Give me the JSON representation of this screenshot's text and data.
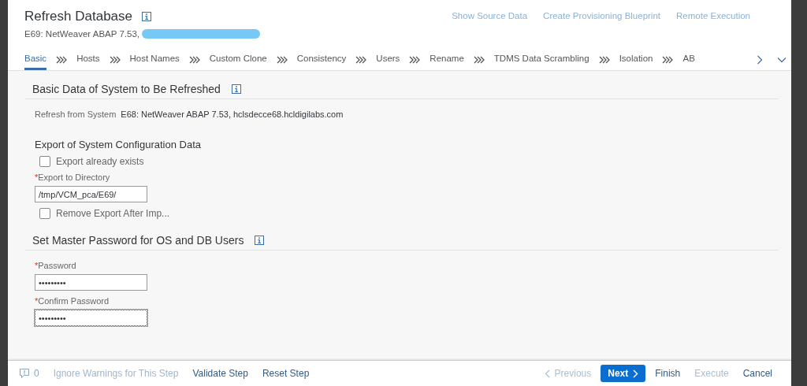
{
  "required_mark": "*",
  "dialog": {
    "title": "Refresh Database",
    "subtitle": "E69: NetWeaver ABAP 7.53,",
    "subtitle_redacted": true,
    "header_links": [
      {
        "label": "Show Source Data",
        "disabled": true
      },
      {
        "label": "Create Provisioning Blueprint",
        "disabled": true
      },
      {
        "label": "Remote Execution",
        "disabled": true
      }
    ]
  },
  "tabs": [
    {
      "label": "Basic",
      "selected": true
    },
    {
      "label": "Hosts",
      "selected": false
    },
    {
      "label": "Host Names",
      "selected": false
    },
    {
      "label": "Custom Clone",
      "selected": false
    },
    {
      "label": "Consistency",
      "selected": false
    },
    {
      "label": "Users",
      "selected": false
    },
    {
      "label": "Rename",
      "selected": false
    },
    {
      "label": "TDMS Data Scrambling",
      "selected": false
    },
    {
      "label": "Isolation",
      "selected": false
    },
    {
      "label": "AB",
      "selected": false
    }
  ],
  "sections": [
    {
      "title": "Basic Data of System to Be Refreshed",
      "info": true,
      "items": [
        {
          "kind": "pair",
          "label": "Refresh from System",
          "value": "E68: NetWeaver ABAP 7.53, hclsdecce68.hcldigilabs.com"
        },
        {
          "kind": "heading",
          "label": "Export of System Configuration Data"
        },
        {
          "kind": "checkbox",
          "label": "Export already exists",
          "checked": false
        },
        {
          "kind": "field",
          "label": "Export to Directory",
          "required": true,
          "value": "/tmp/VCM_pca/E69/",
          "focused": false
        },
        {
          "kind": "checkbox",
          "label": "Remove Export After Imp...",
          "checked": false
        }
      ]
    },
    {
      "title": "Set Master Password for OS and DB Users",
      "info": true,
      "items": [
        {
          "kind": "field",
          "label": "Password",
          "required": true,
          "value": "•••••••••",
          "focused": false
        },
        {
          "kind": "field",
          "label": "Confirm Password",
          "required": true,
          "value": "•••••••••",
          "focused": true
        }
      ]
    }
  ],
  "footer": {
    "message_count": "0",
    "left_actions": [
      {
        "label": "Ignore Warnings for This Step",
        "disabled": true
      },
      {
        "label": "Validate Step",
        "disabled": false
      },
      {
        "label": "Reset Step",
        "disabled": false
      }
    ],
    "right_actions": [
      {
        "label": "Previous",
        "kind": "prev",
        "disabled": true
      },
      {
        "label": "Next",
        "kind": "next",
        "disabled": false
      },
      {
        "label": "Finish",
        "kind": "plain",
        "disabled": false
      },
      {
        "label": "Execute",
        "kind": "plain",
        "disabled": true
      },
      {
        "label": "Cancel",
        "kind": "plain",
        "disabled": false
      }
    ]
  }
}
